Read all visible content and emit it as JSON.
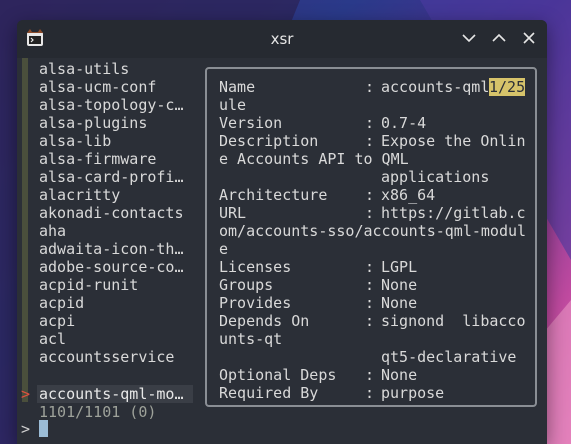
{
  "window": {
    "title": "xsr"
  },
  "packages": [
    "alsa-utils",
    "alsa-ucm-conf",
    "alsa-topology-c…",
    "alsa-plugins",
    "alsa-lib",
    "alsa-firmware",
    "alsa-card-profi…",
    "alacritty",
    "akonadi-contacts",
    "aha",
    "adwaita-icon-th…",
    "adobe-source-co…",
    "acpid-runit",
    "acpid",
    "acpi",
    "acl",
    "accountsservice",
    "accounts-qml-mo…"
  ],
  "selected_marker": ">",
  "match_count": "1101/1101 (0)",
  "prompt": ">",
  "details": {
    "name_line1_label": "Name",
    "name_line1_value": "accounts-qml",
    "page_indicator": "1/25",
    "name_line2": "ule",
    "version_label": "Version",
    "version_value": "0.7-4",
    "description_label": "Description",
    "description_value": "Expose the Onlin",
    "description_line2": "e Accounts API to QML",
    "description_line3": "applications",
    "architecture_label": "Architecture",
    "architecture_value": "x86_64",
    "url_label": "URL",
    "url_value": "https://gitlab.c",
    "url_line2": "om/accounts-sso/accounts-qml-modul",
    "url_line3": "e",
    "licenses_label": "Licenses",
    "licenses_value": "LGPL",
    "groups_label": "Groups",
    "groups_value": "None",
    "provides_label": "Provides",
    "provides_value": "None",
    "depends_label": "Depends On",
    "depends_value": "signond  libacco",
    "depends_line2": "unts-qt",
    "depends_line3": "qt5-declarative",
    "optdeps_label": "Optional Deps",
    "optdeps_value": "None",
    "requiredby_label": "Required By",
    "requiredby_value": "purpose",
    "colon": ":"
  },
  "colors": {
    "terminal_bg": "#2b2f37",
    "highlight": "#d6c36a",
    "marker": "#e0503f",
    "cursor": "#9bbcd6"
  }
}
